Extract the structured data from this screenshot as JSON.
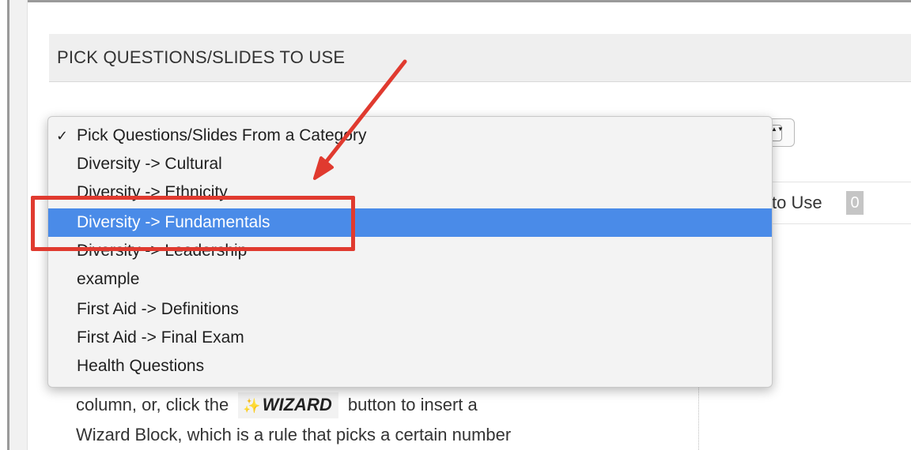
{
  "section_header": {
    "title": "PICK QUESTIONS/SLIDES TO USE"
  },
  "dropdown": {
    "checked_mark": "✓",
    "items": [
      {
        "label": "Pick Questions/Slides From a Category",
        "checked": true,
        "selected": false
      },
      {
        "label": "Diversity -> Cultural",
        "checked": false,
        "selected": false
      },
      {
        "label": "Diversity -> Ethnicity",
        "checked": false,
        "selected": false
      },
      {
        "label": "Diversity -> Fundamentals",
        "checked": false,
        "selected": true
      },
      {
        "label": "Diversity -> Leadership",
        "checked": false,
        "selected": false
      },
      {
        "label": "example",
        "checked": false,
        "selected": false
      },
      {
        "label": "First Aid -> Definitions",
        "checked": false,
        "selected": false
      },
      {
        "label": "First Aid -> Final Exam",
        "checked": false,
        "selected": false
      },
      {
        "label": "Health Questions",
        "checked": false,
        "selected": false
      }
    ],
    "stepper_glyph": "▲▼"
  },
  "count_row": {
    "label": "to Use",
    "count": "0"
  },
  "help": {
    "line1_before": "column, or, click the",
    "wizard_label": "WIZARD",
    "line1_after": "button to insert a",
    "line2": "Wizard Block, which is a rule that picks a certain number"
  },
  "icons": {
    "wand": "wand-icon",
    "stepper": "select-stepper-icon"
  },
  "colors": {
    "selection": "#4a8be8",
    "annotation": "#e03a2f",
    "header_bg": "#efefef"
  }
}
